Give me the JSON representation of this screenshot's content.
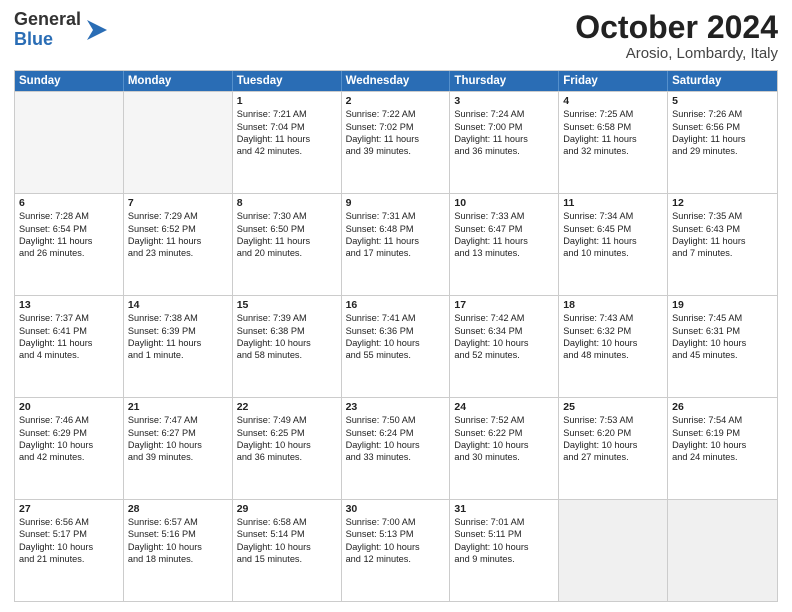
{
  "logo": {
    "general": "General",
    "blue": "Blue"
  },
  "header": {
    "month": "October 2024",
    "location": "Arosio, Lombardy, Italy"
  },
  "days": [
    "Sunday",
    "Monday",
    "Tuesday",
    "Wednesday",
    "Thursday",
    "Friday",
    "Saturday"
  ],
  "rows": [
    [
      {
        "num": "",
        "lines": [],
        "empty": true
      },
      {
        "num": "",
        "lines": [],
        "empty": true
      },
      {
        "num": "1",
        "lines": [
          "Sunrise: 7:21 AM",
          "Sunset: 7:04 PM",
          "Daylight: 11 hours",
          "and 42 minutes."
        ]
      },
      {
        "num": "2",
        "lines": [
          "Sunrise: 7:22 AM",
          "Sunset: 7:02 PM",
          "Daylight: 11 hours",
          "and 39 minutes."
        ]
      },
      {
        "num": "3",
        "lines": [
          "Sunrise: 7:24 AM",
          "Sunset: 7:00 PM",
          "Daylight: 11 hours",
          "and 36 minutes."
        ]
      },
      {
        "num": "4",
        "lines": [
          "Sunrise: 7:25 AM",
          "Sunset: 6:58 PM",
          "Daylight: 11 hours",
          "and 32 minutes."
        ]
      },
      {
        "num": "5",
        "lines": [
          "Sunrise: 7:26 AM",
          "Sunset: 6:56 PM",
          "Daylight: 11 hours",
          "and 29 minutes."
        ]
      }
    ],
    [
      {
        "num": "6",
        "lines": [
          "Sunrise: 7:28 AM",
          "Sunset: 6:54 PM",
          "Daylight: 11 hours",
          "and 26 minutes."
        ]
      },
      {
        "num": "7",
        "lines": [
          "Sunrise: 7:29 AM",
          "Sunset: 6:52 PM",
          "Daylight: 11 hours",
          "and 23 minutes."
        ]
      },
      {
        "num": "8",
        "lines": [
          "Sunrise: 7:30 AM",
          "Sunset: 6:50 PM",
          "Daylight: 11 hours",
          "and 20 minutes."
        ]
      },
      {
        "num": "9",
        "lines": [
          "Sunrise: 7:31 AM",
          "Sunset: 6:48 PM",
          "Daylight: 11 hours",
          "and 17 minutes."
        ]
      },
      {
        "num": "10",
        "lines": [
          "Sunrise: 7:33 AM",
          "Sunset: 6:47 PM",
          "Daylight: 11 hours",
          "and 13 minutes."
        ]
      },
      {
        "num": "11",
        "lines": [
          "Sunrise: 7:34 AM",
          "Sunset: 6:45 PM",
          "Daylight: 11 hours",
          "and 10 minutes."
        ]
      },
      {
        "num": "12",
        "lines": [
          "Sunrise: 7:35 AM",
          "Sunset: 6:43 PM",
          "Daylight: 11 hours",
          "and 7 minutes."
        ]
      }
    ],
    [
      {
        "num": "13",
        "lines": [
          "Sunrise: 7:37 AM",
          "Sunset: 6:41 PM",
          "Daylight: 11 hours",
          "and 4 minutes."
        ]
      },
      {
        "num": "14",
        "lines": [
          "Sunrise: 7:38 AM",
          "Sunset: 6:39 PM",
          "Daylight: 11 hours",
          "and 1 minute."
        ]
      },
      {
        "num": "15",
        "lines": [
          "Sunrise: 7:39 AM",
          "Sunset: 6:38 PM",
          "Daylight: 10 hours",
          "and 58 minutes."
        ]
      },
      {
        "num": "16",
        "lines": [
          "Sunrise: 7:41 AM",
          "Sunset: 6:36 PM",
          "Daylight: 10 hours",
          "and 55 minutes."
        ]
      },
      {
        "num": "17",
        "lines": [
          "Sunrise: 7:42 AM",
          "Sunset: 6:34 PM",
          "Daylight: 10 hours",
          "and 52 minutes."
        ]
      },
      {
        "num": "18",
        "lines": [
          "Sunrise: 7:43 AM",
          "Sunset: 6:32 PM",
          "Daylight: 10 hours",
          "and 48 minutes."
        ]
      },
      {
        "num": "19",
        "lines": [
          "Sunrise: 7:45 AM",
          "Sunset: 6:31 PM",
          "Daylight: 10 hours",
          "and 45 minutes."
        ]
      }
    ],
    [
      {
        "num": "20",
        "lines": [
          "Sunrise: 7:46 AM",
          "Sunset: 6:29 PM",
          "Daylight: 10 hours",
          "and 42 minutes."
        ]
      },
      {
        "num": "21",
        "lines": [
          "Sunrise: 7:47 AM",
          "Sunset: 6:27 PM",
          "Daylight: 10 hours",
          "and 39 minutes."
        ]
      },
      {
        "num": "22",
        "lines": [
          "Sunrise: 7:49 AM",
          "Sunset: 6:25 PM",
          "Daylight: 10 hours",
          "and 36 minutes."
        ]
      },
      {
        "num": "23",
        "lines": [
          "Sunrise: 7:50 AM",
          "Sunset: 6:24 PM",
          "Daylight: 10 hours",
          "and 33 minutes."
        ]
      },
      {
        "num": "24",
        "lines": [
          "Sunrise: 7:52 AM",
          "Sunset: 6:22 PM",
          "Daylight: 10 hours",
          "and 30 minutes."
        ]
      },
      {
        "num": "25",
        "lines": [
          "Sunrise: 7:53 AM",
          "Sunset: 6:20 PM",
          "Daylight: 10 hours",
          "and 27 minutes."
        ]
      },
      {
        "num": "26",
        "lines": [
          "Sunrise: 7:54 AM",
          "Sunset: 6:19 PM",
          "Daylight: 10 hours",
          "and 24 minutes."
        ]
      }
    ],
    [
      {
        "num": "27",
        "lines": [
          "Sunrise: 6:56 AM",
          "Sunset: 5:17 PM",
          "Daylight: 10 hours",
          "and 21 minutes."
        ]
      },
      {
        "num": "28",
        "lines": [
          "Sunrise: 6:57 AM",
          "Sunset: 5:16 PM",
          "Daylight: 10 hours",
          "and 18 minutes."
        ]
      },
      {
        "num": "29",
        "lines": [
          "Sunrise: 6:58 AM",
          "Sunset: 5:14 PM",
          "Daylight: 10 hours",
          "and 15 minutes."
        ]
      },
      {
        "num": "30",
        "lines": [
          "Sunrise: 7:00 AM",
          "Sunset: 5:13 PM",
          "Daylight: 10 hours",
          "and 12 minutes."
        ]
      },
      {
        "num": "31",
        "lines": [
          "Sunrise: 7:01 AM",
          "Sunset: 5:11 PM",
          "Daylight: 10 hours",
          "and 9 minutes."
        ]
      },
      {
        "num": "",
        "lines": [],
        "empty": true,
        "shaded": true
      },
      {
        "num": "",
        "lines": [],
        "empty": true,
        "shaded": true
      }
    ]
  ]
}
